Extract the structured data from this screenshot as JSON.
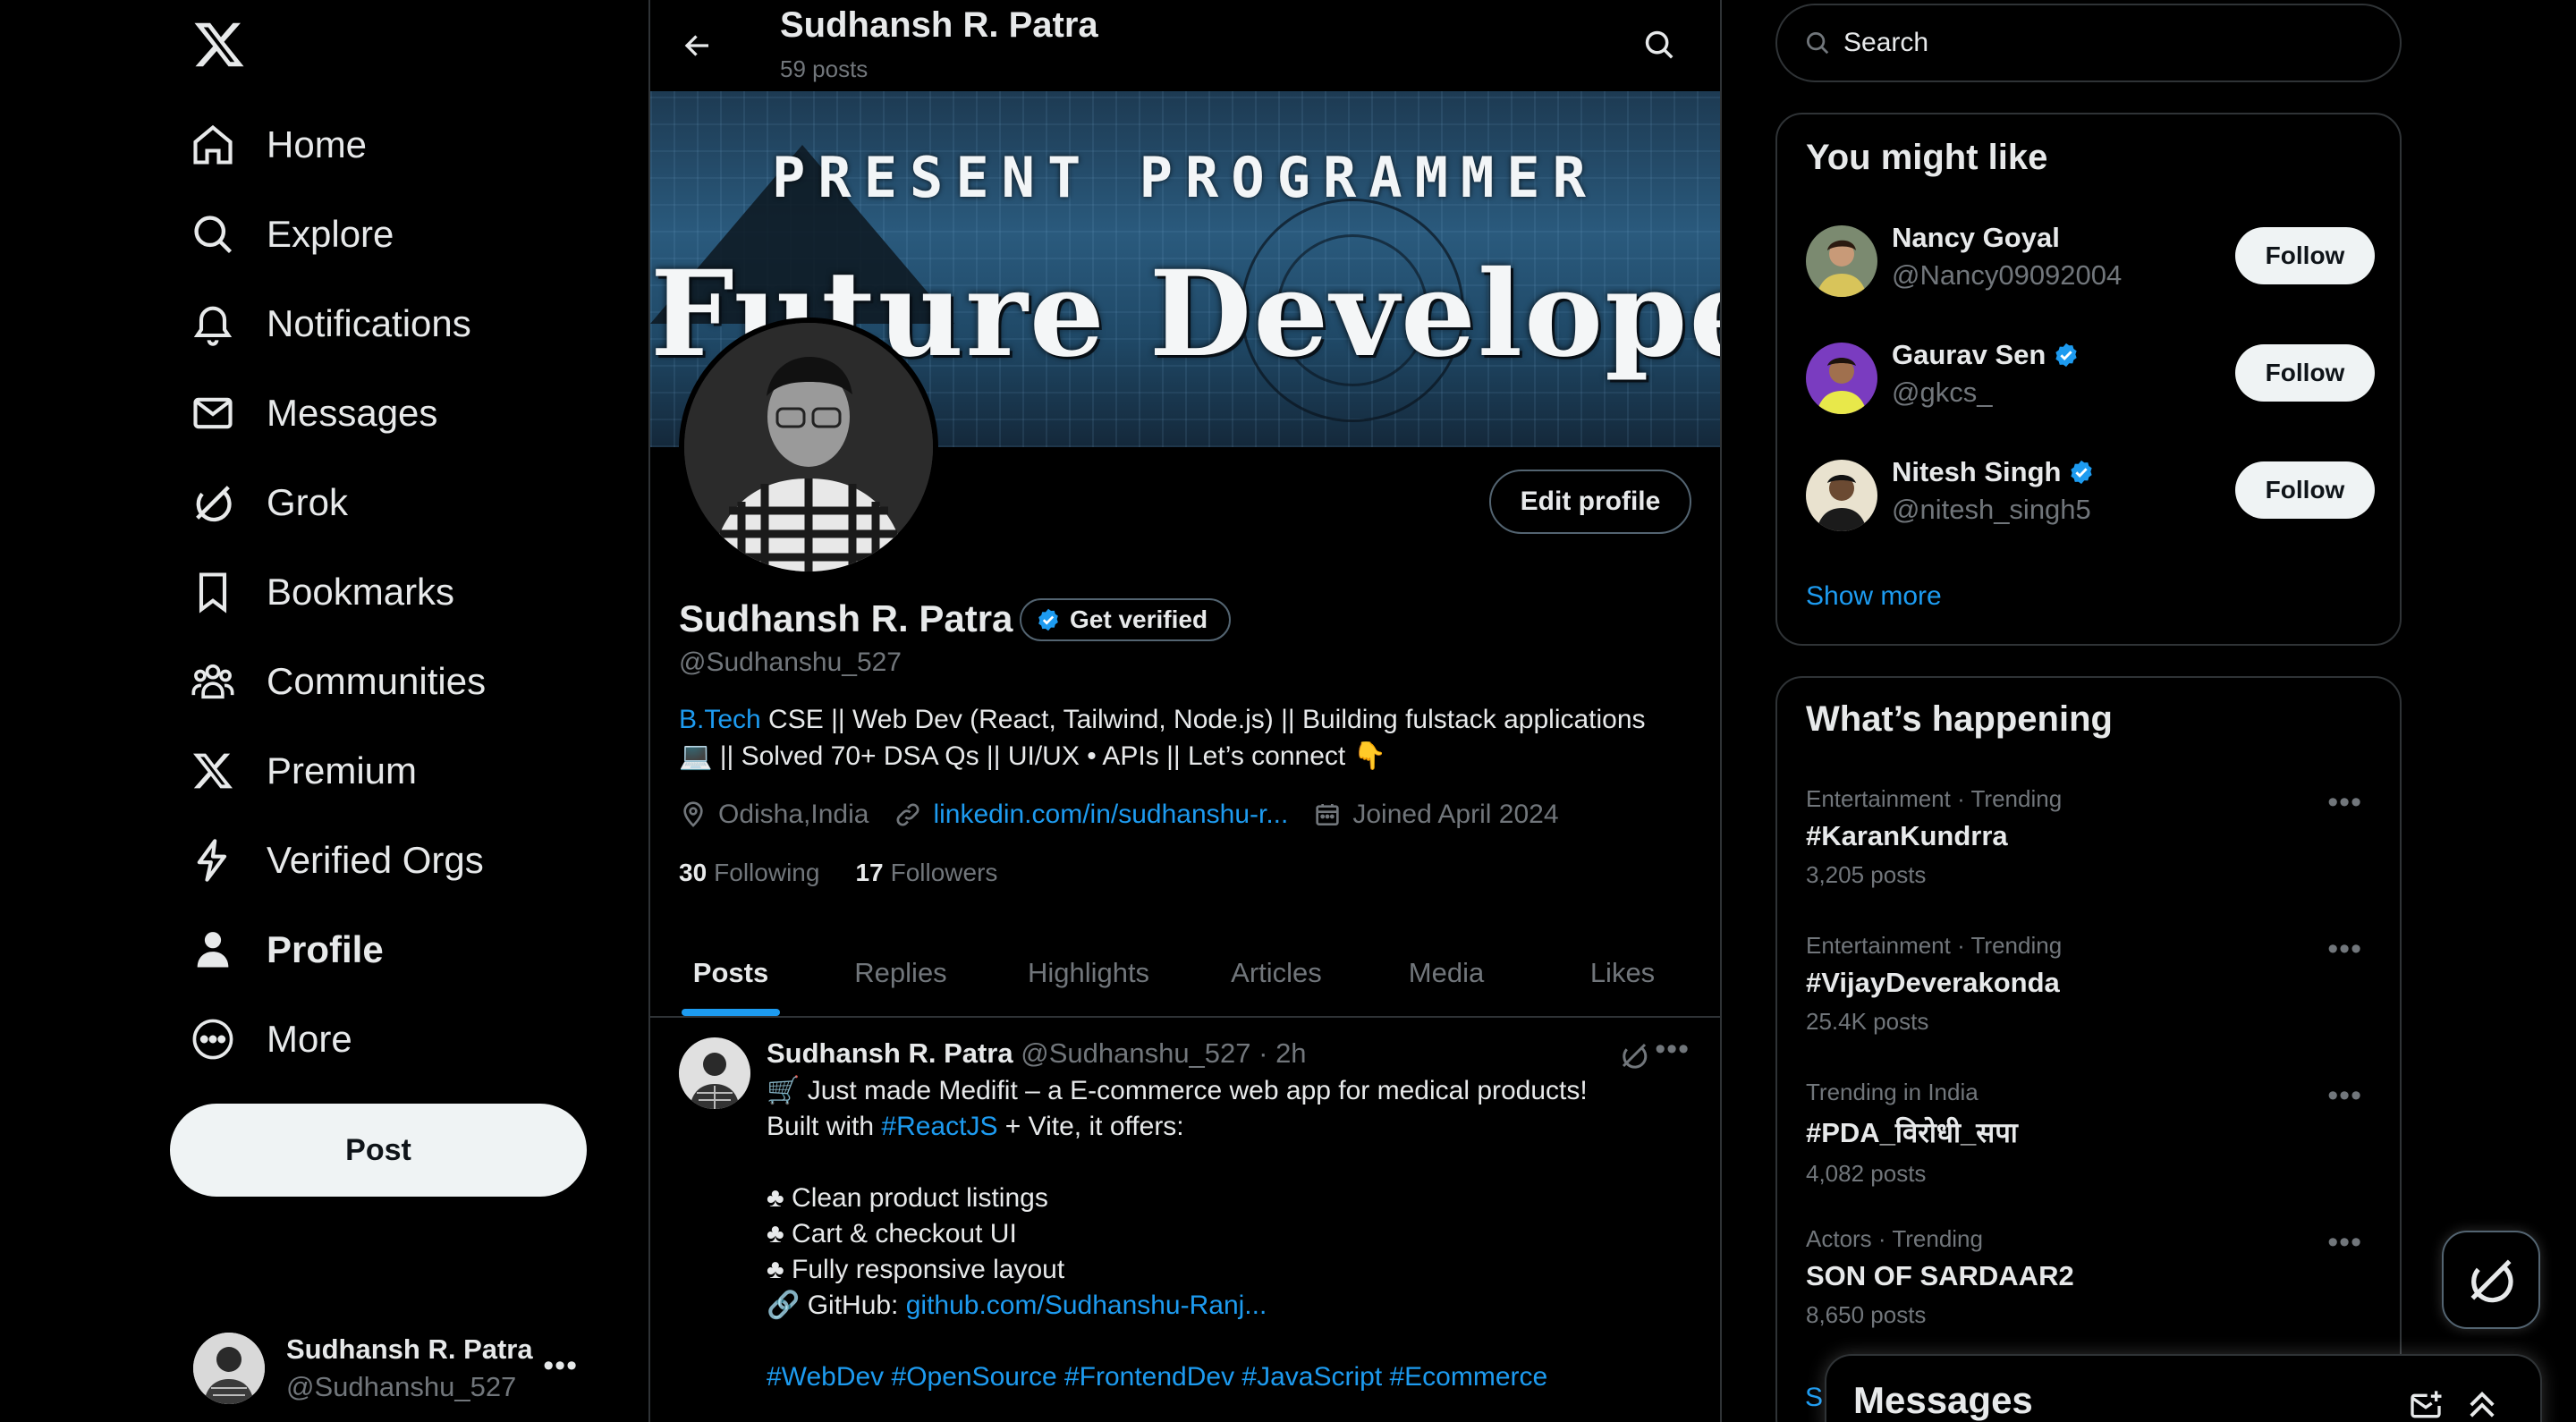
{
  "nav": {
    "items": [
      {
        "label": "Home",
        "icon": "home-icon"
      },
      {
        "label": "Explore",
        "icon": "search-icon"
      },
      {
        "label": "Notifications",
        "icon": "bell-icon"
      },
      {
        "label": "Messages",
        "icon": "envelope-icon"
      },
      {
        "label": "Grok",
        "icon": "grok-icon"
      },
      {
        "label": "Bookmarks",
        "icon": "bookmark-icon"
      },
      {
        "label": "Communities",
        "icon": "communities-icon"
      },
      {
        "label": "Premium",
        "icon": "x-logo-icon"
      },
      {
        "label": "Verified Orgs",
        "icon": "lightning-icon"
      },
      {
        "label": "Profile",
        "icon": "person-icon"
      },
      {
        "label": "More",
        "icon": "more-circle-icon"
      }
    ],
    "active": "Profile",
    "post_label": "Post",
    "account": {
      "name": "Sudhansh R. Patra",
      "handle": "@Sudhanshu_527"
    }
  },
  "header": {
    "name": "Sudhansh R. Patra",
    "posts": "59 posts"
  },
  "banner": {
    "line1": "PRESENT PROGRAMMER",
    "line2": "Future Developer"
  },
  "profile": {
    "edit_label": "Edit profile",
    "name": "Sudhansh R. Patra",
    "get_verified": "Get verified",
    "handle": "@Sudhanshu_527",
    "bio_link": "B.Tech",
    "bio_line1_rest": " CSE || Web Dev (React, Tailwind, Node.js) || Building fulstack applications",
    "bio_line2": "💻 || Solved 70+ DSA Qs || UI/UX • APIs || Let’s connect 👇",
    "location": "Odisha,India",
    "website": "linkedin.com/in/sudhanshu-r...",
    "joined": "Joined April 2024",
    "following_count": "30",
    "following_label": "Following",
    "followers_count": "17",
    "followers_label": "Followers"
  },
  "tabs": [
    "Posts",
    "Replies",
    "Highlights",
    "Articles",
    "Media",
    "Likes"
  ],
  "active_tab": "Posts",
  "tweet": {
    "name": "Sudhansh R. Patra",
    "meta": " @Sudhanshu_527 · 2h",
    "line1": "🛒 Just made Medifit – a E-commerce web app for medical products!",
    "line2_pre": "Built with ",
    "line2_link": "#ReactJS",
    "line2_post": " + Vite, it offers:",
    "bullets": [
      "♣ Clean product listings",
      "♣ Cart & checkout UI",
      "♣ Fully responsive layout"
    ],
    "github_pre": "🔗 GitHub: ",
    "github_link": "github.com/Sudhanshu-Ranj...",
    "hashtags": "#WebDev #OpenSource #FrontendDev #JavaScript #Ecommerce"
  },
  "search": {
    "placeholder": "Search"
  },
  "who_to_follow": {
    "title": "You might like",
    "users": [
      {
        "name": "Nancy Goyal",
        "handle": "@Nancy09092004",
        "verified": false,
        "button": "Follow"
      },
      {
        "name": "Gaurav Sen",
        "handle": "@gkcs_",
        "verified": true,
        "button": "Follow"
      },
      {
        "name": "Nitesh Singh",
        "handle": "@nitesh_singh5",
        "verified": true,
        "button": "Follow"
      }
    ],
    "show_more": "Show more"
  },
  "trends": {
    "title": "What’s happening",
    "items": [
      {
        "context": "Entertainment · Trending",
        "title": "#KaranKundrra",
        "count": "3,205 posts"
      },
      {
        "context": "Entertainment · Trending",
        "title": "#VijayDeverakonda",
        "count": "25.4K posts"
      },
      {
        "context": "Trending in India",
        "title": "#PDA_विरोधी_सपा",
        "count": "4,082 posts"
      },
      {
        "context": "Actors · Trending",
        "title": "SON OF SARDAAR2",
        "count": "8,650 posts"
      }
    ],
    "peek": "S"
  },
  "messages_drawer": {
    "title": "Messages"
  },
  "colors": {
    "accent": "#1d9bf0",
    "text": "#e7e9ea",
    "muted": "#71767b",
    "border": "#2f3336",
    "background": "#000000"
  }
}
